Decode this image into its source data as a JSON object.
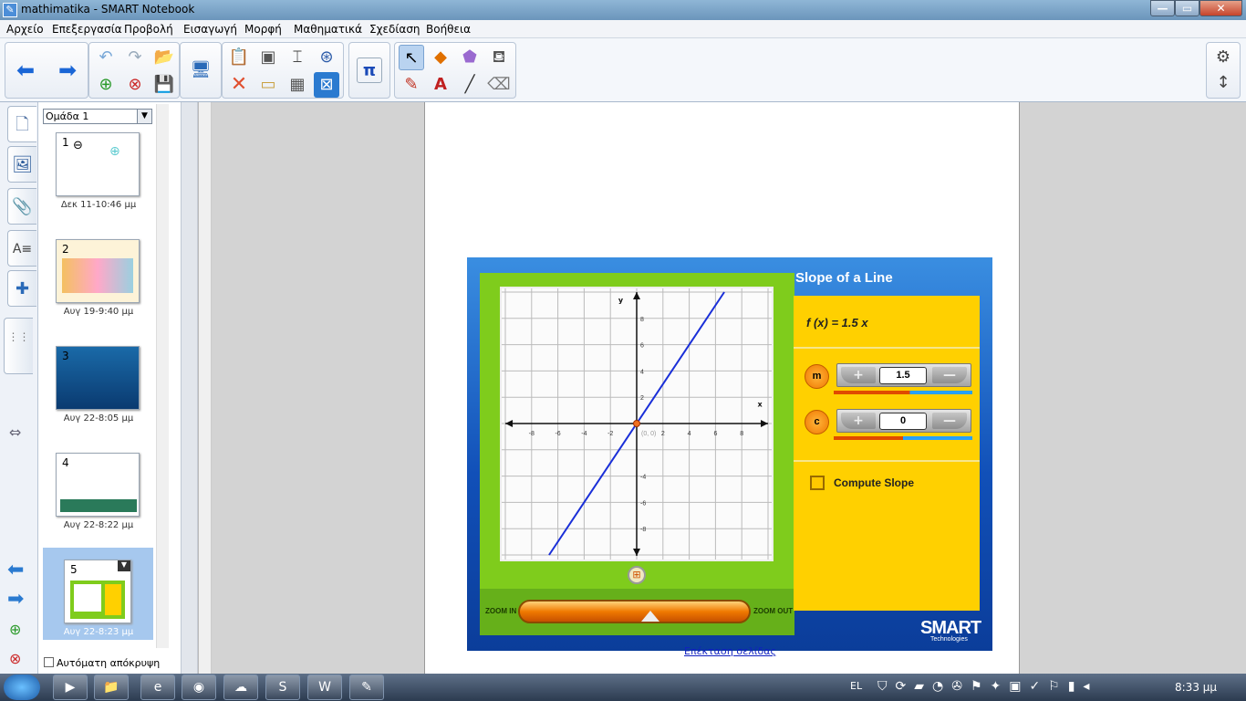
{
  "window": {
    "title": "mathimatika - SMART Notebook",
    "app_icon": "notebook-icon",
    "minimize": "—",
    "maximize": "▭",
    "close": "✕"
  },
  "menu": [
    "Αρχείο",
    "Επεξεργασία",
    "Προβολή",
    "Εισαγωγή",
    "Μορφή",
    "Μαθηματικά",
    "Σχεδίαση",
    "Βοήθεια"
  ],
  "toolbar": {
    "groups": [
      {
        "icons": [
          "back-arrow-icon",
          "forward-arrow-icon"
        ]
      },
      {
        "icons": [
          "undo-icon",
          "redo-icon",
          "open-file-icon",
          "add-page-icon",
          "delete-page-icon",
          "save-icon"
        ]
      },
      {
        "icons": [
          "screen-display-icon"
        ]
      },
      {
        "icons": [
          "paste-icon",
          "screen-shade-icon",
          "insert-text-icon",
          "capture-icon",
          "delete-icon",
          "toggle-display-icon",
          "table-icon",
          "clear-icon"
        ]
      },
      {
        "icons": [
          "math-tools-icon"
        ]
      },
      {
        "icons": [
          "select-icon",
          "shapes-icon",
          "eraser-shape-icon",
          "fill-icon",
          "pens-icon",
          "text-icon",
          "line-icon",
          "eraser-icon"
        ]
      }
    ],
    "math_label": "π"
  },
  "sorter": {
    "group": "Ομάδα 1",
    "pages": [
      {
        "num": "1",
        "date": "Δεκ 11-10:46 μμ"
      },
      {
        "num": "2",
        "date": "Αυγ 19-9:40 μμ"
      },
      {
        "num": "3",
        "date": "Αυγ 22-8:05 μμ"
      },
      {
        "num": "4",
        "date": "Αυγ 22-8:22 μμ"
      },
      {
        "num": "5",
        "date": "Αυγ 22-8:23 μμ"
      }
    ],
    "autohide": "Αυτόματη απόκρυψη"
  },
  "widget": {
    "title": "Slope of a Line",
    "function": "f (x) = 1.5 x",
    "m_label": "m",
    "m_value": "1.5",
    "c_label": "c",
    "c_value": "0",
    "compute": "Compute Slope",
    "zoom_in": "ZOOM IN",
    "zoom_out": "ZOOM OUT",
    "logo": "SMART",
    "logo_sub": "Technologies",
    "origin_label": "(0, 0)",
    "axis_x": "x",
    "axis_y": "y"
  },
  "link": "Επέκταση σελίδας",
  "taskbar": {
    "lang": "EL",
    "clock": "8:33 μμ",
    "apps": [
      "media-player-icon",
      "explorer-icon",
      "ie-icon",
      "firefox-icon",
      "network-icon",
      "skype-icon",
      "word-icon",
      "notebook-icon"
    ]
  },
  "chart_data": {
    "type": "line",
    "title": "",
    "xlabel": "x",
    "ylabel": "y",
    "xlim": [
      -10,
      10
    ],
    "ylim": [
      -10,
      10
    ],
    "xticks": [
      -8,
      -6,
      -4,
      -2,
      2,
      4,
      6,
      8
    ],
    "yticks": [
      8,
      6,
      4,
      2,
      -4,
      -6,
      -8
    ],
    "grid": true,
    "series": [
      {
        "values": [
          {
            "x": -6.67,
            "y": -10
          },
          {
            "x": 6.67,
            "y": 10
          }
        ],
        "color": "#1a2fd8"
      }
    ],
    "point": {
      "x": 0,
      "y": 0,
      "label": "(0, 0)"
    }
  }
}
